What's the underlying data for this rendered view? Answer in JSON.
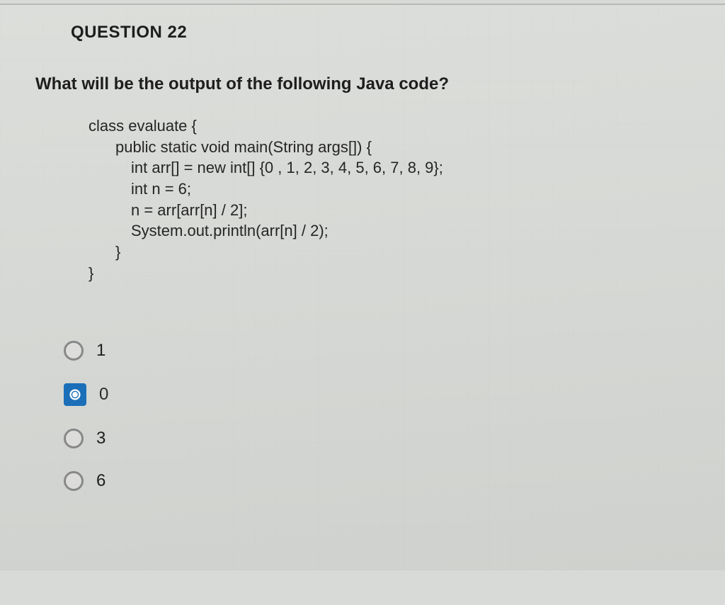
{
  "question_number": "QUESTION 22",
  "question_text": "What will be the output of the following Java code?",
  "code": {
    "line1": "class evaluate {",
    "line2": "public static void main(String args[]) {",
    "line3": "int arr[] = new int[] {0 , 1, 2, 3, 4, 5, 6, 7, 8, 9};",
    "line4": "int n = 6;",
    "line5": "n = arr[arr[n] / 2];",
    "line6": "System.out.println(arr[n] / 2);",
    "line7": "}",
    "line8": "}"
  },
  "options": {
    "a": "1",
    "b": "0",
    "c": "3",
    "d": "6"
  },
  "selected_index": 1
}
